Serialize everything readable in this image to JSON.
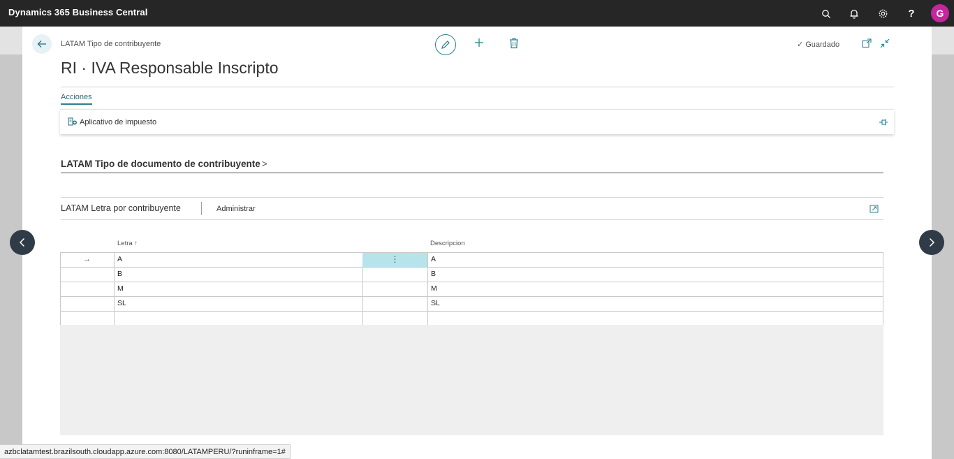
{
  "app": {
    "title": "Dynamics 365 Business Central",
    "user_initial": "G"
  },
  "topbar_icons": [
    "search-icon",
    "bell-icon",
    "gear-icon",
    "help-icon"
  ],
  "help_label": "?",
  "page": {
    "breadcrumb": "LATAM Tipo de contribuyente",
    "title": "RI · IVA Responsable Inscripto",
    "saved_label": "Guardado"
  },
  "actions": {
    "tab_label": "Acciones",
    "items": [
      {
        "label": "Aplicativo de impuesto",
        "icon": "tax-app-icon"
      }
    ]
  },
  "sections": {
    "doc_type_title": "LATAM Tipo de documento de contribuyente",
    "letter_title": "LATAM Letra por contribuyente",
    "manage_label": "Administrar"
  },
  "grid": {
    "columns": [
      "Letra ↑",
      "Descripcion"
    ],
    "rows": [
      {
        "letra": "A",
        "descripcion": "A"
      },
      {
        "letra": "B",
        "descripcion": "B"
      },
      {
        "letra": "M",
        "descripcion": "M"
      },
      {
        "letra": "SL",
        "descripcion": "SL"
      },
      {
        "letra": "",
        "descripcion": ""
      }
    ]
  },
  "status_url": "azbclatamtest.brazilsouth.cloudapp.azure.com:8080/LATAMPERU/?runinframe=1#",
  "colors": {
    "accent": "#2b7f8e",
    "topbar": "#262626",
    "avatar": "#c4269b",
    "selected_cell": "#b6e4ea"
  }
}
